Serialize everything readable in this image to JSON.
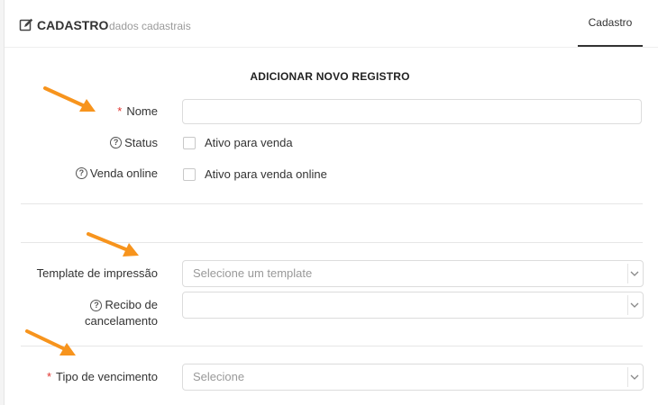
{
  "header": {
    "title": "CADASTRO",
    "subtitle": "dados cadastrais",
    "tab_label": "Cadastro",
    "edit_icon": "edit-icon"
  },
  "form": {
    "section_title": "ADICIONAR NOVO REGISTRO",
    "required_mark": "*",
    "help_mark": "?",
    "nome": {
      "label": "Nome",
      "value": ""
    },
    "status": {
      "label": "Status",
      "checkbox_label": "Ativo para venda",
      "checked": false
    },
    "venda_online": {
      "label": "Venda online",
      "checkbox_label": "Ativo para venda online",
      "checked": false
    },
    "template": {
      "label": "Template de impressão",
      "placeholder": "Selecione um template"
    },
    "recibo": {
      "label_line1": "Recibo de",
      "label_line2": "cancelamento",
      "value": ""
    },
    "vencimento": {
      "label": "Tipo de vencimento",
      "placeholder": "Selecione"
    }
  },
  "colors": {
    "accent_arrow": "#f7941d",
    "required": "#e0322d"
  }
}
